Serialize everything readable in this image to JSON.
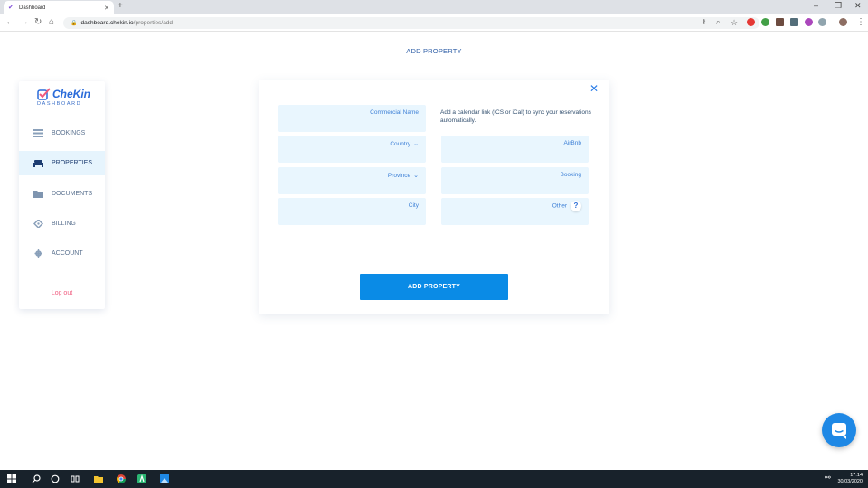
{
  "browser": {
    "tab_title": "Dashboard",
    "new_tab_label": "+",
    "url_host": "dashboard.chekin.io",
    "url_path": "/properties/add"
  },
  "page": {
    "heading": "ADD PROPERTY"
  },
  "sidebar": {
    "logo_text": "CheKin",
    "logo_subtitle": "DASHBOARD",
    "items": [
      {
        "label": "BOOKINGS",
        "icon": "list-icon",
        "active": false
      },
      {
        "label": "PROPERTIES",
        "icon": "bed-icon",
        "active": true
      },
      {
        "label": "DOCUMENTS",
        "icon": "folder-icon",
        "active": false
      },
      {
        "label": "BILLING",
        "icon": "tag-icon",
        "active": false
      },
      {
        "label": "ACCOUNT",
        "icon": "gear-icon",
        "active": false
      }
    ],
    "logout_label": "Log out"
  },
  "form": {
    "commercial_name_label": "Commercial Name",
    "country_label": "Country",
    "province_label": "Province",
    "city_label": "City",
    "calendar_hint": "Add a calendar link (ICS or iCal) to sync your reservations automatically.",
    "airbnb_label": "AirBnb",
    "booking_label": "Booking",
    "other_label": "Other",
    "help_glyph": "?",
    "submit_label": "ADD PROPERTY"
  },
  "taskbar": {
    "time": "17:14",
    "date": "30/03/2020"
  },
  "colors": {
    "accent": "#0a8be6",
    "field_bg": "#e9f6fe",
    "logout": "#f05a7e"
  }
}
